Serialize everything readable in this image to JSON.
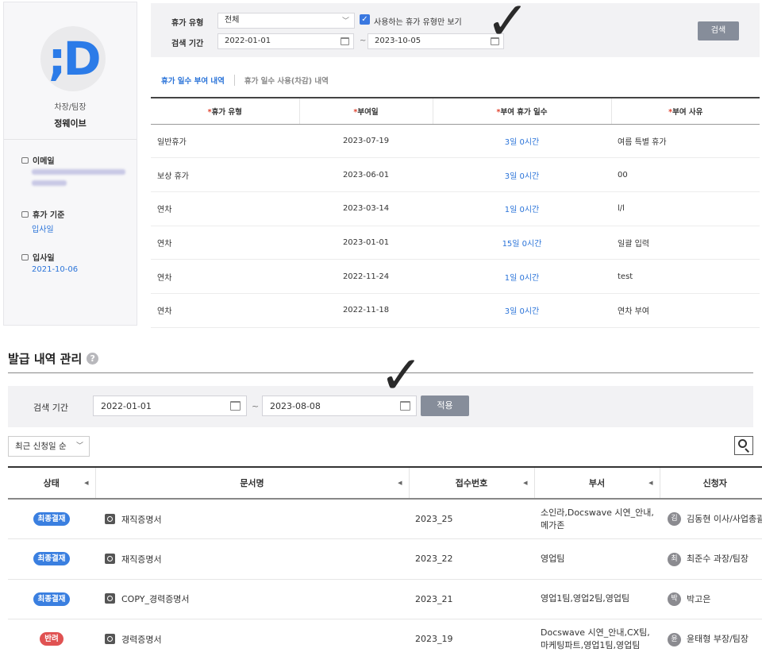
{
  "profile": {
    "rank": "차장/팀장",
    "name": "정웨이브",
    "email_label": "이메일",
    "vacation_basis_label": "휴가 기준",
    "vacation_basis_value": "입사일",
    "join_date_label": "입사일",
    "join_date_value": "2021-10-06"
  },
  "vacation_search": {
    "type_label": "휴가 유형",
    "type_value": "전체",
    "only_used_label": "사용하는 휴가 유형만 보기",
    "period_label": "검색 기간",
    "date_from": "2022-01-01",
    "tilde": "~",
    "date_to": "2023-10-05",
    "search_button": "검색"
  },
  "vacation_tabs": [
    {
      "label": "휴가 일수 부여 내역",
      "active": true
    },
    {
      "label": "휴가 일수 사용(차감) 내역",
      "active": false
    }
  ],
  "grant_table": {
    "headers": [
      "휴가 유형",
      "부여일",
      "부여 휴가 일수",
      "부여 사유"
    ],
    "required_mark": "*",
    "rows": [
      {
        "type": "일반휴가",
        "date": "2023-07-19",
        "days": "3일 0시간",
        "reason": "여름 특별 휴가"
      },
      {
        "type": "보상 휴가",
        "date": "2023-06-01",
        "days": "3일 0시간",
        "reason": "00"
      },
      {
        "type": "연차",
        "date": "2023-03-14",
        "days": "1일 0시간",
        "reason": "l/l"
      },
      {
        "type": "연차",
        "date": "2023-01-01",
        "days": "15일 0시간",
        "reason": "일괄 입력"
      },
      {
        "type": "연차",
        "date": "2022-11-24",
        "days": "1일 0시간",
        "reason": "test"
      },
      {
        "type": "연차",
        "date": "2022-11-18",
        "days": "3일 0시간",
        "reason": "연차 부여"
      }
    ]
  },
  "check_mark": "✓",
  "issue_section": {
    "title": "발급 내역 관리",
    "help": "?",
    "search_label": "검색 기간",
    "date_from": "2022-01-01",
    "tilde": "~",
    "date_to": "2023-08-08",
    "apply_button": "적용",
    "sort_value": "최근 신청일 순",
    "columns": [
      "상태",
      "문서명",
      "접수번호",
      "부서",
      "신청자"
    ],
    "rows": [
      {
        "status": "최종결재",
        "status_color": "#3a7fe0",
        "doc": "재직증명서",
        "no": "2023_25",
        "dept": [
          "소인라,Docswave 시연_안내,",
          "메가존"
        ],
        "initial": "김",
        "requester": "김동현 이사/사업총괄"
      },
      {
        "status": "최종결재",
        "status_color": "#3a7fe0",
        "doc": "재직증명서",
        "no": "2023_22",
        "dept": [
          "영업팀"
        ],
        "initial": "최",
        "requester": "최준수 과장/팀장"
      },
      {
        "status": "최종결재",
        "status_color": "#3a7fe0",
        "doc": "COPY_경력증명서",
        "no": "2023_21",
        "dept": [
          "영업1팀,영업2팀,영업팀"
        ],
        "initial": "박",
        "requester": "박고은"
      },
      {
        "status": "반려",
        "status_color": "#e05252",
        "doc": "경력증명서",
        "no": "2023_19",
        "dept": [
          "Docswave 시연_안내,CX팀,",
          "마케팅파트,영업1팀,영업팀"
        ],
        "initial": "윤",
        "requester": "윤태형 부장/팀장"
      }
    ]
  }
}
